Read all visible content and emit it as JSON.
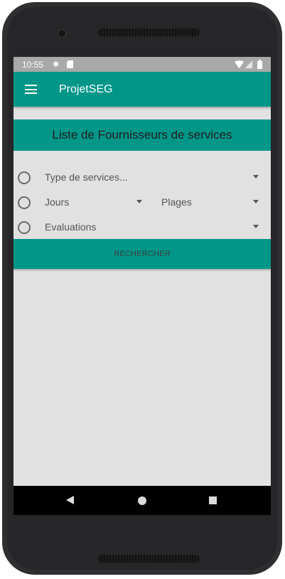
{
  "status_bar": {
    "time": "10:55",
    "icons": [
      "settings-icon",
      "sd-card-icon",
      "wifi-icon",
      "signal-icon",
      "battery-icon"
    ]
  },
  "app_bar": {
    "title": "ProjetSEG",
    "menu_icon": "hamburger-menu-icon"
  },
  "list_header": "Liste de Fournisseurs de services",
  "filters": {
    "service_type": {
      "selected": "Type de services..."
    },
    "days": {
      "selected": "Jours"
    },
    "ranges": {
      "selected": "Plages"
    },
    "ratings": {
      "selected": "Evaluations"
    }
  },
  "search_button": "RECHERCHER",
  "nav_bar": {
    "buttons": [
      "back-icon",
      "home-icon",
      "recent-apps-icon"
    ]
  },
  "colors": {
    "primary": "#009688",
    "status_bar": "#a9a9a9",
    "background": "#e1e1e1",
    "nav_bar": "#000000"
  }
}
